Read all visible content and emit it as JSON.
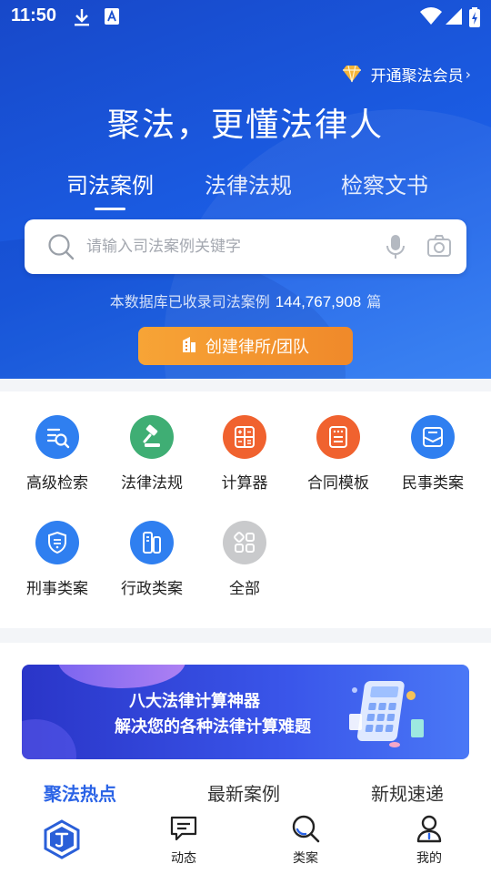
{
  "status_bar": {
    "time": "11:50"
  },
  "header": {
    "vip_label": "开通聚法会员",
    "slogan": "聚法，更懂法律人",
    "tabs": [
      {
        "label": "司法案例",
        "active": true
      },
      {
        "label": "法律法规",
        "active": false
      },
      {
        "label": "检察文书",
        "active": false
      }
    ],
    "search": {
      "placeholder": "请输入司法案例关键字",
      "value": ""
    },
    "db_count": {
      "prefix": "本数据库已收录司法案例",
      "number": "144,767,908",
      "suffix": "篇"
    },
    "create_button": "创建律所/团队"
  },
  "grid": [
    {
      "label": "高级检索",
      "icon": "advanced-search-icon",
      "color": "#2f7ff0"
    },
    {
      "label": "法律法规",
      "icon": "gavel-icon",
      "color": "#3fae74"
    },
    {
      "label": "计算器",
      "icon": "calculator-icon",
      "color": "#f0622f"
    },
    {
      "label": "合同模板",
      "icon": "contract-icon",
      "color": "#f0622f"
    },
    {
      "label": "民事类案",
      "icon": "envelope-icon",
      "color": "#2f7ff0"
    },
    {
      "label": "刑事类案",
      "icon": "shield-icon",
      "color": "#2f7ff0"
    },
    {
      "label": "行政类案",
      "icon": "admin-case-icon",
      "color": "#2f7ff0"
    },
    {
      "label": "全部",
      "icon": "all-apps-icon",
      "color": "#c9cacc"
    }
  ],
  "banner": {
    "line1": "八大法律计算神器",
    "line2": "解决您的各种法律计算难题"
  },
  "news_tabs": [
    {
      "label": "聚法热点",
      "active": true
    },
    {
      "label": "最新案例",
      "active": false
    },
    {
      "label": "新规速递",
      "active": false
    }
  ],
  "bottom_nav": [
    {
      "label": "",
      "icon": "jufa-logo-icon"
    },
    {
      "label": "动态",
      "icon": "message-icon"
    },
    {
      "label": "类案",
      "icon": "search-icon"
    },
    {
      "label": "我的",
      "icon": "user-icon"
    }
  ]
}
